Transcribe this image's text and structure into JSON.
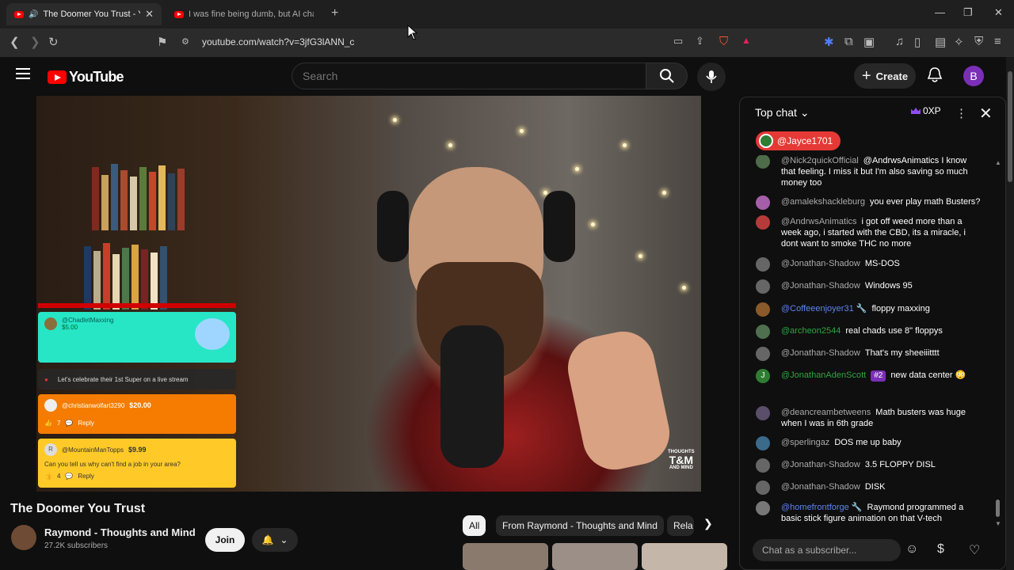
{
  "browser": {
    "tabs": [
      {
        "title": "The Doomer You Trust - YouT",
        "active": true
      },
      {
        "title": "I was fine being dumb, but AI change",
        "active": false
      }
    ],
    "url": "youtube.com/watch?v=3jfG3lANN_c"
  },
  "youtube": {
    "logo_text": "YouTube",
    "search_placeholder": "Search",
    "create_label": "Create",
    "avatar_letter": "B"
  },
  "video": {
    "title": "The Doomer You Trust",
    "watermark_line1": "THOUGHTS",
    "watermark_line2": "T&M",
    "watermark_line3": "AND MIND",
    "superchats": [
      {
        "user": "@ChadletMaxxing",
        "amount": "$5.00"
      },
      {
        "banner": "Let's celebrate their 1st Super on a live stream"
      },
      {
        "user": "@christianwolfart3290",
        "amount": "$20.00",
        "likes": "7",
        "reply": "Reply"
      },
      {
        "user": "@MountainManTopps",
        "amount": "$9.99",
        "message": "Can you tell us why can't find a job in your area?",
        "likes": "4",
        "reply": "Reply",
        "avatar_letter": "R"
      }
    ]
  },
  "channel": {
    "name": "Raymond - Thoughts and Mind",
    "subscribers": "27.2K subscribers",
    "join_label": "Join"
  },
  "chips": [
    "All",
    "From Raymond - Thoughts and Mind",
    "Rela"
  ],
  "chat": {
    "header": "Top chat",
    "xp": "0XP",
    "pinned_user": "@Jayce1701",
    "input_placeholder": "Chat as a subscriber...",
    "messages": [
      {
        "author": "@Nick2quickOfficial",
        "text": "@AndrwsAnimatics I know that feeling. I miss it but I'm also saving so much money too",
        "author_color": "gray"
      },
      {
        "author": "@amalekshackleburg",
        "text": "you ever play math Busters?",
        "author_color": "gray"
      },
      {
        "author": "@AndrwsAnimatics",
        "text": "i got off weed more than a week ago, i started with the CBD, its a miracle, i dont want to smoke THC no more",
        "author_color": "gray"
      },
      {
        "author": "@Jonathan-Shadow",
        "text": "MS-DOS",
        "author_color": "gray"
      },
      {
        "author": "@Jonathan-Shadow",
        "text": "Windows 95",
        "author_color": "gray"
      },
      {
        "author": "@Coffeeenjoyer31 🔧",
        "text": "floppy maxxing",
        "author_color": "blue"
      },
      {
        "author": "@archeon2544",
        "text": "real chads use 8\" floppys",
        "author_color": "green"
      },
      {
        "author": "@Jonathan-Shadow",
        "text": "That's my sheeiiitttt",
        "author_color": "gray"
      },
      {
        "author": "@JonathanAdenScott",
        "badge": "#2",
        "text": "new data center 😳",
        "author_color": "green"
      },
      {
        "author": "@deancreambetweens",
        "text": "Math busters was huge when I was in 6th grade",
        "author_color": "gray"
      },
      {
        "author": "@sperlingaz",
        "text": "DOS me up baby",
        "author_color": "gray"
      },
      {
        "author": "@Jonathan-Shadow",
        "text": "3.5 FLOPPY DISL",
        "author_color": "gray"
      },
      {
        "author": "@Jonathan-Shadow",
        "text": "DISK",
        "author_color": "gray"
      },
      {
        "author": "@homefrontforge 🔧",
        "text": "Raymond programmed a basic stick figure animation on that V-tech",
        "author_color": "blue"
      }
    ]
  },
  "colors": {
    "brand_red": "#ff0000",
    "chat_pinned": "#e53935",
    "superchat_teal": "#27e6c6",
    "superchat_orange": "#f57c00",
    "superchat_yellow": "#ffca28",
    "member_purple": "#7b2fb7"
  }
}
